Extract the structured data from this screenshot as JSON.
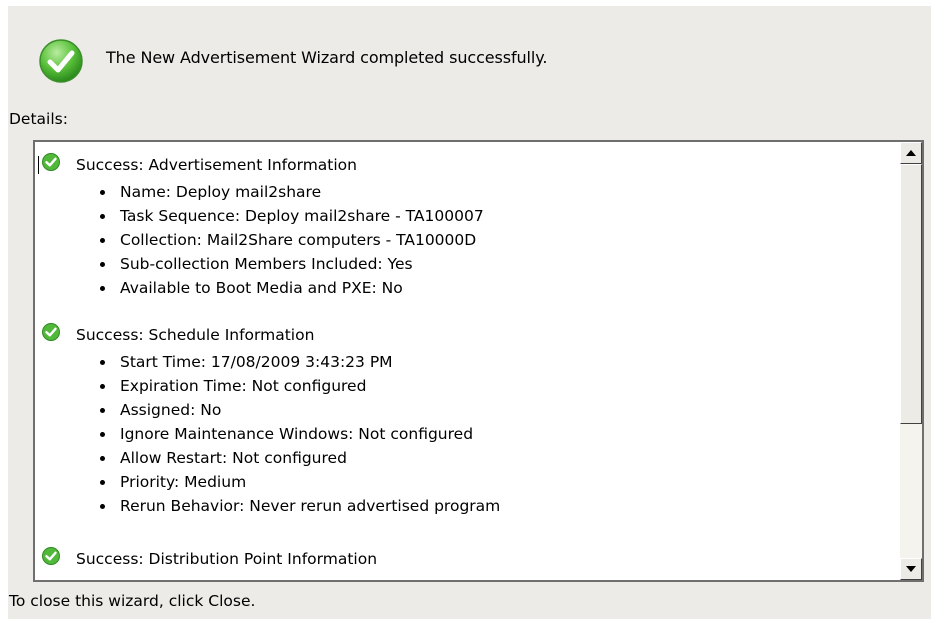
{
  "header": {
    "status_icon": "success-check-icon",
    "message": "The New Advertisement Wizard completed successfully."
  },
  "details": {
    "label": "Details:",
    "sections": [
      {
        "icon": "success-check-icon",
        "title": "Success: Advertisement Information",
        "items": [
          "Name: Deploy mail2share",
          "Task Sequence: Deploy mail2share - TA100007",
          "Collection: Mail2Share computers - TA10000D",
          "Sub-collection Members Included: Yes",
          "Available to Boot Media and PXE: No"
        ]
      },
      {
        "icon": "success-check-icon",
        "title": "Success: Schedule Information",
        "items": [
          "Start Time: 17/08/2009 3:43:23 PM",
          "Expiration Time: Not configured",
          "Assigned: No",
          "Ignore Maintenance Windows: Not configured",
          "Allow Restart: Not configured",
          "Priority: Medium",
          "Rerun Behavior: Never rerun advertised program"
        ]
      },
      {
        "icon": "success-check-icon",
        "title": "Success: Distribution Point Information",
        "items": []
      }
    ]
  },
  "footer": {
    "instruction": "To close this wizard, click Close."
  },
  "colors": {
    "dialog_background": "#ecebe8",
    "success_green": "#3cae2a",
    "list_background": "#ffffff"
  }
}
